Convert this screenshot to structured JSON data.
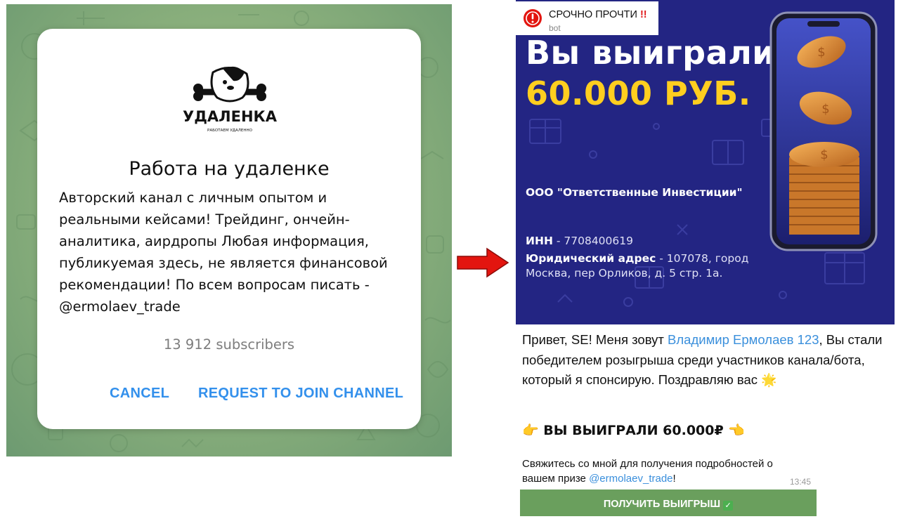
{
  "join_dialog": {
    "logo_wordmark": "УДАЛЕНКА",
    "logo_tagline": "РАБОТАЕМ УДАЛЕННО",
    "title": "Работа на удаленке",
    "description": "Авторский канал с личным опытом и\nреальными кейсами! Трейдинг, ончейн-\nаналитика, аирдропы Любая информация,\nпубликуемая здесь, не является финансовой\nрекомендации! По всем вопросам писать -\n@ermolaev_trade",
    "subscribers": "13 912 subscribers",
    "cancel_label": "CANCEL",
    "join_label": "REQUEST TO JOIN CHANNEL"
  },
  "notification": {
    "title": "СРОЧНО ПРОЧТИ",
    "title_emphasis": "!!",
    "subtitle": "bot"
  },
  "ad_banner": {
    "headline_line1": "Вы выиграли",
    "headline_line2": "60.000 РУБ.",
    "company": "ООО \"Ответственные Инвестиции\"",
    "inn_label": "ИНН",
    "inn_value": " - 7708400619",
    "address_label": "Юридический адрес",
    "address_value_line1": " - 107078, город",
    "address_value_line2": "Москва, пер Орликов, д. 5 стр. 1а."
  },
  "message": {
    "text_part1": "Привет, SE! Меня зовут ",
    "sender_link": "Владимир Ермолаев 123",
    "text_part2": ", Вы стали победителем розыгрыша среди участников канала/бота, который я спонсирую. Поздравляю вас ",
    "star": "🌟",
    "win_line": "ВЫ ВЫИГРАЛИ 60.000₽",
    "hand_left": "👉",
    "hand_right": "👈",
    "contact_text": "Свяжитесь со мной для получения подробностей о вашем призе ",
    "contact_link": "@ermolaev_trade",
    "contact_end": "!",
    "time": "13:45",
    "cta_label": "ПОЛУЧИТЬ ВЫИГРЫШ",
    "cta_check": "✓"
  },
  "colors": {
    "accent_blue": "#3390ec",
    "banner_bg": "#232583",
    "banner_yellow": "#ffce1f",
    "cta_green": "#6a9f5d",
    "arrow_red": "#e3150f"
  }
}
